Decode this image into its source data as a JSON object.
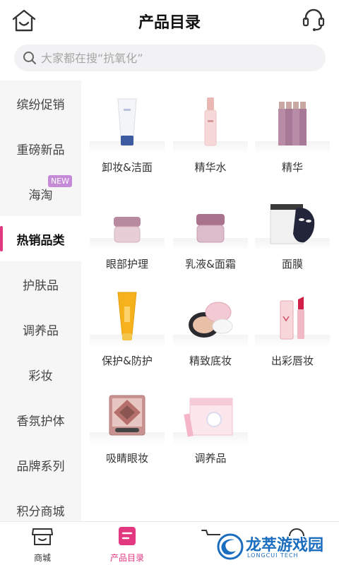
{
  "header": {
    "title": "产品目录",
    "home_icon": "home-icon",
    "service_icon": "headset-icon"
  },
  "search": {
    "placeholder": "大家都在搜“抗氧化”",
    "icon": "search-icon"
  },
  "sidebar": {
    "active_color": "#e2387f",
    "items": [
      {
        "label": "缤纷促销"
      },
      {
        "label": "重磅新品"
      },
      {
        "label": "海淘",
        "badge": "NEW"
      },
      {
        "label": "热销品类",
        "active": true
      },
      {
        "label": "护肤品"
      },
      {
        "label": "调养品"
      },
      {
        "label": "彩妆"
      },
      {
        "label": "香氛护体"
      },
      {
        "label": "品牌系列"
      },
      {
        "label": "积分商城"
      }
    ]
  },
  "categories": [
    {
      "label": "卸妆&洁面",
      "image": "cleanser-tube"
    },
    {
      "label": "精华水",
      "image": "essence-bottle"
    },
    {
      "label": "精华",
      "image": "serum-vials"
    },
    {
      "label": "眼部护理",
      "image": "eye-cream-jar"
    },
    {
      "label": "乳液&面霜",
      "image": "face-cream-jar"
    },
    {
      "label": "面膜",
      "image": "sheet-mask-and-jar"
    },
    {
      "label": "保护&防护",
      "image": "sunscreen-tube"
    },
    {
      "label": "精致底妆",
      "image": "cushion-compact"
    },
    {
      "label": "出彩唇妆",
      "image": "lipstick"
    },
    {
      "label": "吸睛眼妆",
      "image": "eyeshadow-palette"
    },
    {
      "label": "调养品",
      "image": "supplement-box"
    }
  ],
  "tabbar": {
    "active_color": "#e2387f",
    "tabs": [
      {
        "label": "商城",
        "icon": "shop-icon"
      },
      {
        "label": "产品目录",
        "icon": "catalog-icon",
        "active": true
      },
      {
        "label": "",
        "icon": "cart-icon"
      },
      {
        "label": "",
        "icon": "profile-icon"
      }
    ]
  },
  "watermark": {
    "text": "龙萃游戏园",
    "sub": "LONGCUI TECH"
  }
}
